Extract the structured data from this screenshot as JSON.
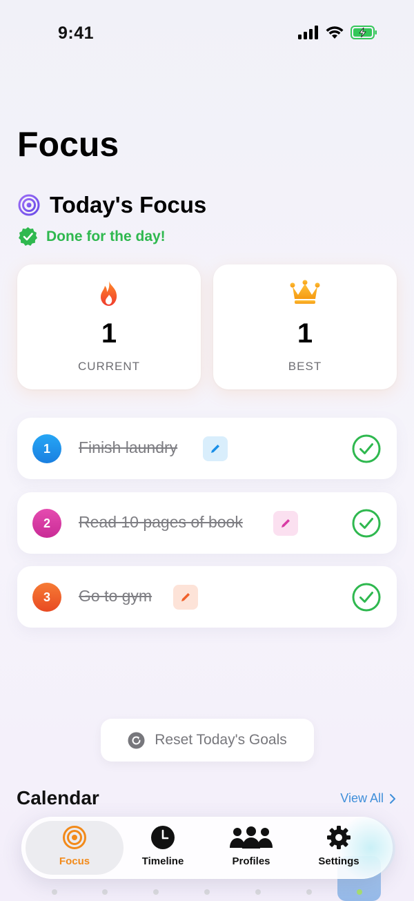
{
  "status_bar": {
    "time": "9:41"
  },
  "page": {
    "title": "Focus"
  },
  "today": {
    "title": "Today's Focus",
    "status": "Done for the day!"
  },
  "streak": {
    "current": {
      "value": "1",
      "label": "CURRENT"
    },
    "best": {
      "value": "1",
      "label": "BEST"
    }
  },
  "tasks": [
    {
      "number": "1",
      "text": "Finish laundry",
      "color": "#1a8fe8",
      "edit_bg": "#d9eefc",
      "edit_color": "#1a8fe8",
      "completed": true
    },
    {
      "number": "2",
      "text": "Read 10 pages of book",
      "color": "#d83aa4",
      "edit_bg": "#fbe0f0",
      "edit_color": "#d83aa4",
      "completed": true
    },
    {
      "number": "3",
      "text": "Go to gym",
      "color": "#f0602a",
      "edit_bg": "#fde3d8",
      "edit_color": "#f0602a",
      "completed": true
    }
  ],
  "reset": {
    "label": "Reset Today's Goals"
  },
  "calendar": {
    "title": "Calendar",
    "view_all": "View All"
  },
  "tab_bar": {
    "tabs": [
      {
        "label": "Focus",
        "icon": "target-icon",
        "active": true
      },
      {
        "label": "Timeline",
        "icon": "clock-icon",
        "active": false
      },
      {
        "label": "Profiles",
        "icon": "people-icon",
        "active": false
      },
      {
        "label": "Settings",
        "icon": "gear-icon",
        "active": false
      }
    ]
  },
  "colors": {
    "accent": "#f28a1a",
    "success": "#2fb84f",
    "link": "#3f8fd9",
    "target": "#8a5cf0"
  }
}
